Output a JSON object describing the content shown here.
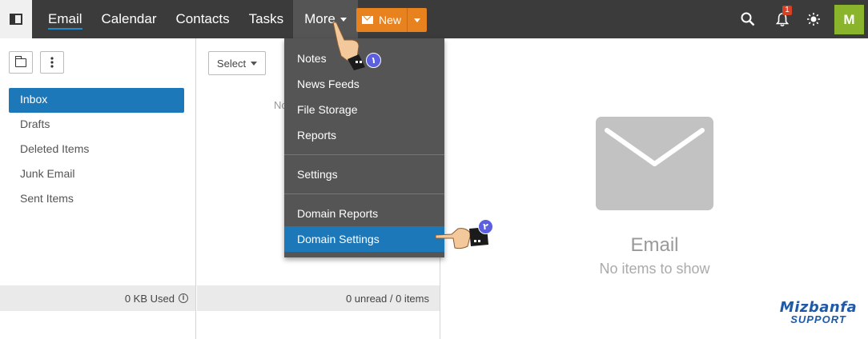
{
  "topbar": {
    "nav": [
      "Email",
      "Calendar",
      "Contacts",
      "Tasks"
    ],
    "more_label": "More",
    "new_label": "New",
    "notification_count": "1",
    "avatar_initial": "M",
    "colors": {
      "bar": "#3b3b3b",
      "accent": "#1c78b9",
      "new_button": "#e8821f",
      "avatar": "#8ab42c",
      "badge": "#d64126"
    }
  },
  "sidebar": {
    "folders": [
      "Inbox",
      "Drafts",
      "Deleted Items",
      "Junk Email",
      "Sent Items"
    ],
    "active_folder": "Inbox",
    "usage": "0 KB Used"
  },
  "list": {
    "select_label": "Select",
    "empty_text": "No",
    "status": "0 unread / 0 items"
  },
  "reading": {
    "title": "Email",
    "subtitle": "No items to show"
  },
  "more_menu": {
    "items": [
      "Notes",
      "News Feeds",
      "File Storage",
      "Reports",
      "Settings",
      "Domain Reports",
      "Domain Settings"
    ],
    "highlighted": "Domain Settings"
  },
  "annotations": {
    "step1": "١",
    "step2": "٢"
  },
  "watermark": {
    "brand": "Mizbanfa",
    "tag": "SUPPORT"
  }
}
